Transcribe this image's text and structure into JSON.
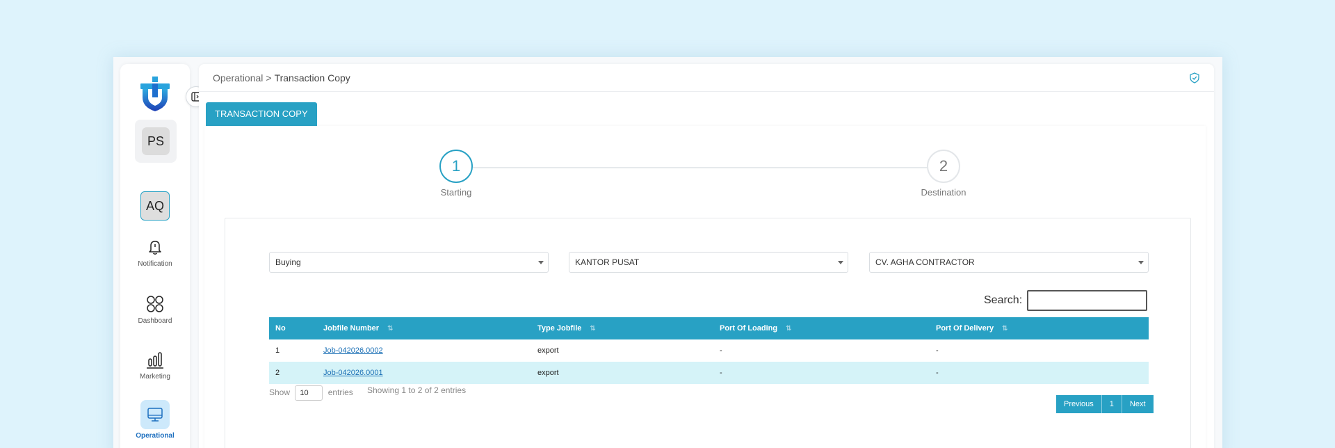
{
  "sidebar": {
    "user_initials": "PS",
    "account_initials": "AQ",
    "nav": [
      {
        "label": "Notification",
        "icon": "bell-icon"
      },
      {
        "label": "Dashboard",
        "icon": "grid-icon"
      },
      {
        "label": "Marketing",
        "icon": "bar-chart-icon"
      },
      {
        "label": "Operational",
        "icon": "monitor-icon",
        "active": true
      }
    ]
  },
  "header": {
    "breadcrumb": [
      "Operational",
      "Transaction Copy"
    ],
    "separator": ">"
  },
  "tab": {
    "label": "TRANSACTION COPY"
  },
  "stepper": [
    {
      "number": "1",
      "label": "Starting",
      "active": true
    },
    {
      "number": "2",
      "label": "Destination",
      "active": false
    }
  ],
  "filters": {
    "type": "Buying",
    "branch": "KANTOR PUSAT",
    "company": "CV. AGHA CONTRACTOR"
  },
  "search": {
    "label": "Search:",
    "value": ""
  },
  "table": {
    "columns": [
      "No",
      "Jobfile Number",
      "Type Jobfile",
      "Port Of Loading",
      "Port Of Delivery"
    ],
    "rows": [
      {
        "no": "1",
        "jobfile": "Job-042026.0002",
        "type": "export",
        "pol": "-",
        "pod": "-"
      },
      {
        "no": "2",
        "jobfile": "Job-042026.0001",
        "type": "export",
        "pol": "-",
        "pod": "-"
      }
    ]
  },
  "length_menu": {
    "prefix": "Show",
    "value": "10",
    "suffix": "entries"
  },
  "info": "Showing 1 to 2 of 2 entries",
  "pagination": {
    "previous": "Previous",
    "page": "1",
    "next": "Next"
  },
  "colors": {
    "accent": "#28a1c4",
    "row_highlight": "#d5f3f8",
    "active_nav": "#1d6fbf"
  }
}
